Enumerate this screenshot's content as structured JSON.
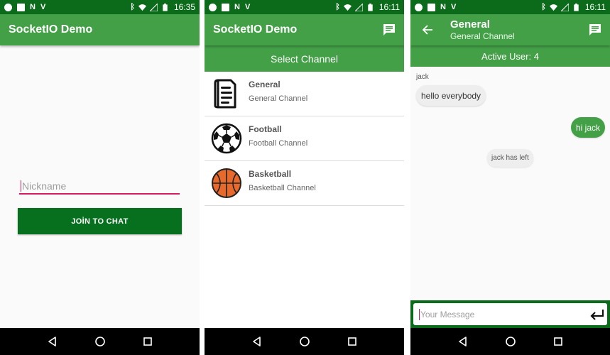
{
  "colors": {
    "primary": "#43a047",
    "primary_dark": "#0b6b1a",
    "button": "#07701e",
    "accent": "#d81b60"
  },
  "login_screen": {
    "status": {
      "time": "16:35"
    },
    "appbar": {
      "title": "SocketIO Demo"
    },
    "nickname_field": {
      "placeholder": "Nickname",
      "value": ""
    },
    "join_button": {
      "label": "JOİN TO CHAT"
    }
  },
  "channel_screen": {
    "status": {
      "time": "16:11"
    },
    "appbar": {
      "title": "SocketIO Demo",
      "action_icon": "chat-icon"
    },
    "header": "Select Channel",
    "channels": [
      {
        "name": "General",
        "description": "General Channel",
        "icon": "document-icon"
      },
      {
        "name": "Football",
        "description": "Football Channel",
        "icon": "soccer-ball-icon"
      },
      {
        "name": "Basketball",
        "description": "Basketball Channel",
        "icon": "basketball-icon"
      }
    ]
  },
  "chat_screen": {
    "status": {
      "time": "16:11"
    },
    "appbar": {
      "title": "General",
      "subtitle": "General Channel",
      "action_icon": "chat-icon"
    },
    "active_users": "Active User: 4",
    "messages": [
      {
        "sender": "jack",
        "text": "hello everybody",
        "direction": "incoming"
      },
      {
        "sender": "",
        "text": "hi jack",
        "direction": "outgoing"
      },
      {
        "sender": "",
        "text": "jack has left",
        "direction": "system"
      }
    ],
    "composer": {
      "placeholder": "Your Message",
      "value": ""
    }
  }
}
